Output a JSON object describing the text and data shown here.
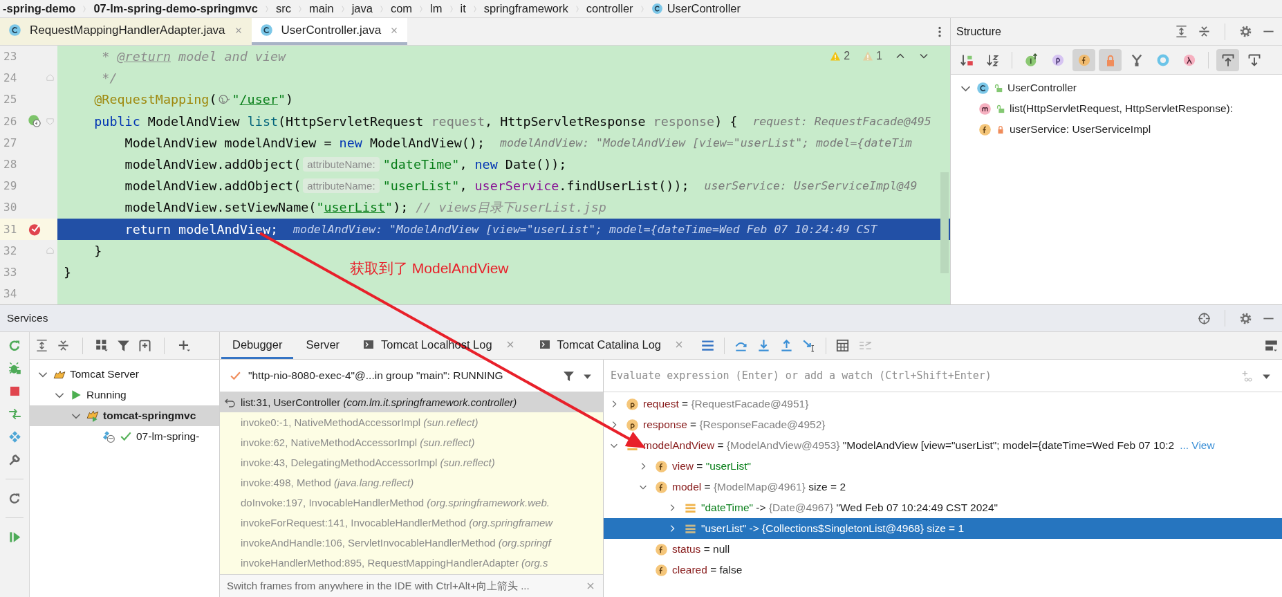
{
  "breadcrumbs": [
    {
      "label": "-spring-demo",
      "kind": "module"
    },
    {
      "label": "07-lm-spring-demo-springmvc",
      "kind": "module"
    },
    {
      "label": "src",
      "kind": "folder"
    },
    {
      "label": "main",
      "kind": "folder"
    },
    {
      "label": "java",
      "kind": "folder"
    },
    {
      "label": "com",
      "kind": "folder"
    },
    {
      "label": "lm",
      "kind": "folder"
    },
    {
      "label": "it",
      "kind": "folder"
    },
    {
      "label": "springframework",
      "kind": "folder"
    },
    {
      "label": "controller",
      "kind": "folder"
    },
    {
      "label": "UserController",
      "kind": "class"
    }
  ],
  "editor_tabs": [
    {
      "label": "RequestMappingHandlerAdapter.java",
      "selected": false
    },
    {
      "label": "UserController.java",
      "selected": true
    }
  ],
  "editor": {
    "inspections": [
      {
        "kind": "warning",
        "count": "2"
      },
      {
        "kind": "weak-warning",
        "count": "1"
      }
    ],
    "lines": [
      {
        "number": "23",
        "selected": false,
        "tokens": [
          {
            "kind": "comment",
            "text": "     * "
          },
          {
            "kind": "doc-tag",
            "text": "@return"
          },
          {
            "kind": "comment",
            "text": " model and view"
          }
        ]
      },
      {
        "number": "24",
        "selected": false,
        "fold_end": true,
        "tokens": [
          {
            "kind": "comment",
            "text": "     */"
          }
        ]
      },
      {
        "number": "25",
        "selected": false,
        "tokens": [
          {
            "kind": "annotation",
            "text": "    @RequestMapping"
          },
          {
            "kind": "plain",
            "text": "("
          },
          {
            "kind": "endpoint-icon"
          },
          {
            "kind": "string",
            "text": "\""
          },
          {
            "kind": "string-link",
            "text": "/user"
          },
          {
            "kind": "string",
            "text": "\""
          },
          {
            "kind": "plain",
            "text": ")"
          }
        ]
      },
      {
        "number": "26",
        "selected": false,
        "endpoint_marker": true,
        "fold_start": true,
        "tokens": [
          {
            "kind": "keyword",
            "text": "    public"
          },
          {
            "kind": "plain",
            "text": " ModelAndView "
          },
          {
            "kind": "method",
            "text": "list"
          },
          {
            "kind": "plain",
            "text": "(HttpServletRequest "
          },
          {
            "kind": "param",
            "text": "request"
          },
          {
            "kind": "plain",
            "text": ", HttpServletResponse "
          },
          {
            "kind": "param",
            "text": "response"
          },
          {
            "kind": "plain",
            "text": ") {"
          },
          {
            "kind": "inline-value",
            "text": "request: RequestFacade@495"
          }
        ]
      },
      {
        "number": "27",
        "selected": false,
        "tokens": [
          {
            "kind": "plain",
            "text": "        ModelAndView modelAndView = "
          },
          {
            "kind": "keyword",
            "text": "new"
          },
          {
            "kind": "plain",
            "text": " ModelAndView();"
          },
          {
            "kind": "inline-value",
            "text": "modelAndView: \"ModelAndView [view=\"userList\"; model={dateTim"
          }
        ]
      },
      {
        "number": "28",
        "selected": false,
        "tokens": [
          {
            "kind": "plain",
            "text": "        modelAndView.addObject("
          },
          {
            "kind": "hint",
            "text": "attributeName:"
          },
          {
            "kind": "string",
            "text": "\"dateTime\""
          },
          {
            "kind": "plain",
            "text": ", "
          },
          {
            "kind": "keyword",
            "text": "new"
          },
          {
            "kind": "plain",
            "text": " Date());"
          }
        ]
      },
      {
        "number": "29",
        "selected": false,
        "tokens": [
          {
            "kind": "plain",
            "text": "        modelAndView.addObject("
          },
          {
            "kind": "hint",
            "text": "attributeName:"
          },
          {
            "kind": "string",
            "text": "\"userList\""
          },
          {
            "kind": "plain",
            "text": ", "
          },
          {
            "kind": "field",
            "text": "userService"
          },
          {
            "kind": "plain",
            "text": ".findUserList());"
          },
          {
            "kind": "inline-value",
            "text": "userService: UserServiceImpl@49"
          }
        ]
      },
      {
        "number": "30",
        "selected": false,
        "tokens": [
          {
            "kind": "plain",
            "text": "        modelAndView.setViewName("
          },
          {
            "kind": "string",
            "text": "\""
          },
          {
            "kind": "string-link",
            "text": "userList"
          },
          {
            "kind": "string",
            "text": "\""
          },
          {
            "kind": "plain",
            "text": "); "
          },
          {
            "kind": "comment",
            "text": "// views目录下userList.jsp"
          }
        ]
      },
      {
        "number": "31",
        "selected": true,
        "breakpoint": true,
        "tokens": [
          {
            "kind": "keyword",
            "text": "        return"
          },
          {
            "kind": "plain",
            "text": " modelAndView;"
          },
          {
            "kind": "inline-value",
            "text": "modelAndView: \"ModelAndView [view=\"userList\"; model={dateTime=Wed Feb 07 10:24:49 CST"
          }
        ]
      },
      {
        "number": "32",
        "selected": false,
        "fold_end": true,
        "tokens": [
          {
            "kind": "plain",
            "text": "    }"
          }
        ]
      },
      {
        "number": "33",
        "selected": false,
        "tokens": [
          {
            "kind": "plain",
            "text": "}"
          }
        ]
      },
      {
        "number": "34",
        "selected": false
      }
    ]
  },
  "structure": {
    "title": "Structure",
    "toolbar": [
      {
        "kind": "sort-visibility",
        "selected": false
      },
      {
        "kind": "sort-alpha",
        "selected": false
      },
      {
        "kind": "inherited",
        "selected": false
      },
      {
        "kind": "properties",
        "selected": false
      },
      {
        "kind": "fields",
        "selected": true
      },
      {
        "kind": "non-public",
        "selected": true
      },
      {
        "kind": "anonymous",
        "selected": false
      },
      {
        "kind": "ring",
        "selected": false
      },
      {
        "kind": "lambda",
        "selected": false
      },
      {
        "kind": "scroll-to-source",
        "selected": true
      },
      {
        "kind": "scroll-from-source",
        "selected": false
      }
    ],
    "tree": [
      {
        "label": "UserController",
        "kind": "class",
        "private": false,
        "expanded": true,
        "children": [
          {
            "label": "list(HttpServletRequest, HttpServletResponse):",
            "kind": "method",
            "private": false
          },
          {
            "label": "userService: UserServiceImpl",
            "kind": "field",
            "private": true
          }
        ]
      }
    ]
  },
  "services": {
    "title": "Services",
    "tree": [
      {
        "label": "Tomcat Server",
        "kind": "server",
        "expanded": true,
        "selected": false,
        "children": [
          {
            "label": "Running",
            "kind": "status",
            "expanded": true,
            "selected": false,
            "children": [
              {
                "label": "tomcat-springmvc",
                "kind": "config",
                "expanded": true,
                "selected": true,
                "children": [
                  {
                    "label": "07-lm-spring-",
                    "kind": "artifact",
                    "selected": false
                  }
                ]
              }
            ]
          }
        ]
      }
    ],
    "debugger_tabs": [
      {
        "label": "Debugger",
        "kind": "plain",
        "selected": true,
        "closable": false
      },
      {
        "label": "Server",
        "kind": "plain",
        "selected": false,
        "closable": false
      },
      {
        "label": "Tomcat Localhost Log",
        "kind": "console",
        "selected": false,
        "closable": true
      },
      {
        "label": "Tomcat Catalina Log",
        "kind": "console",
        "selected": false,
        "closable": true
      }
    ],
    "thread": "\"http-nio-8080-exec-4\"@...in group \"main\": RUNNING",
    "frames": [
      {
        "method": "list:31, UserController",
        "package": "(com.lm.it.springframework.controller)",
        "current": true,
        "selected": true
      },
      {
        "method": "invoke0:-1, NativeMethodAccessorImpl",
        "package": "(sun.reflect)",
        "current": false,
        "selected": false
      },
      {
        "method": "invoke:62, NativeMethodAccessorImpl",
        "package": "(sun.reflect)",
        "current": false,
        "selected": false
      },
      {
        "method": "invoke:43, DelegatingMethodAccessorImpl",
        "package": "(sun.reflect)",
        "current": false,
        "selected": false
      },
      {
        "method": "invoke:498, Method",
        "package": "(java.lang.reflect)",
        "current": false,
        "selected": false
      },
      {
        "method": "doInvoke:197, InvocableHandlerMethod",
        "package": "(org.springframework.web.",
        "current": false,
        "selected": false
      },
      {
        "method": "invokeForRequest:141, InvocableHandlerMethod",
        "package": "(org.springframew",
        "current": false,
        "selected": false
      },
      {
        "method": "invokeAndHandle:106, ServletInvocableHandlerMethod",
        "package": "(org.springf",
        "current": false,
        "selected": false
      },
      {
        "method": "invokeHandlerMethod:895, RequestMappingHandlerAdapter",
        "package": "(org.s",
        "current": false,
        "selected": false
      }
    ],
    "frames_tip": "Switch frames from anywhere in the IDE with Ctrl+Alt+向上箭头 ...",
    "evaluate": {
      "placeholder": "Evaluate expression (Enter) or add a watch (Ctrl+Shift+Enter)"
    },
    "variables": [
      {
        "name": "request",
        "separator": " = ",
        "type": "{RequestFacade@4951}",
        "kind": "parameter",
        "expanded": false,
        "selected": false
      },
      {
        "name": "response",
        "separator": " = ",
        "type": "{ResponseFacade@4952}",
        "kind": "parameter",
        "expanded": false,
        "selected": false
      },
      {
        "name": "modelAndView",
        "separator": " = ",
        "type": "{ModelAndView@4953}",
        "value": "\"ModelAndView [view=\"userList\"; model={dateTime=Wed Feb 07 10:2",
        "link": "... View",
        "kind": "local",
        "expanded": true,
        "selected": false,
        "children": [
          {
            "name": "view",
            "separator": " = ",
            "value": "\"userList\"",
            "string_value": true,
            "kind": "field",
            "expanded": false,
            "selected": false
          },
          {
            "name": "model",
            "separator": " = ",
            "type": "{ModelMap@4961}",
            "extra": "size = 2",
            "kind": "field",
            "expanded": true,
            "selected": false,
            "children": [
              {
                "name": "\"dateTime\"",
                "separator": " -> ",
                "type": "{Date@4967}",
                "value": "\"Wed Feb 07 10:24:49 CST 2024\"",
                "kind": "entry",
                "expanded": false,
                "selected": false
              },
              {
                "name": "\"userList\"",
                "separator": " -> ",
                "type": "{Collections$SingletonList@4968}",
                "extra": "size = 1",
                "kind": "entry",
                "expanded": false,
                "selected": true
              }
            ]
          },
          {
            "name": "status",
            "separator": " = ",
            "value": "null",
            "kind": "field",
            "selected": false
          },
          {
            "name": "cleared",
            "separator": " = ",
            "value": "false",
            "kind": "field",
            "selected": false
          }
        ]
      }
    ]
  },
  "annotation": {
    "text": "获取到了 ModelAndView"
  }
}
